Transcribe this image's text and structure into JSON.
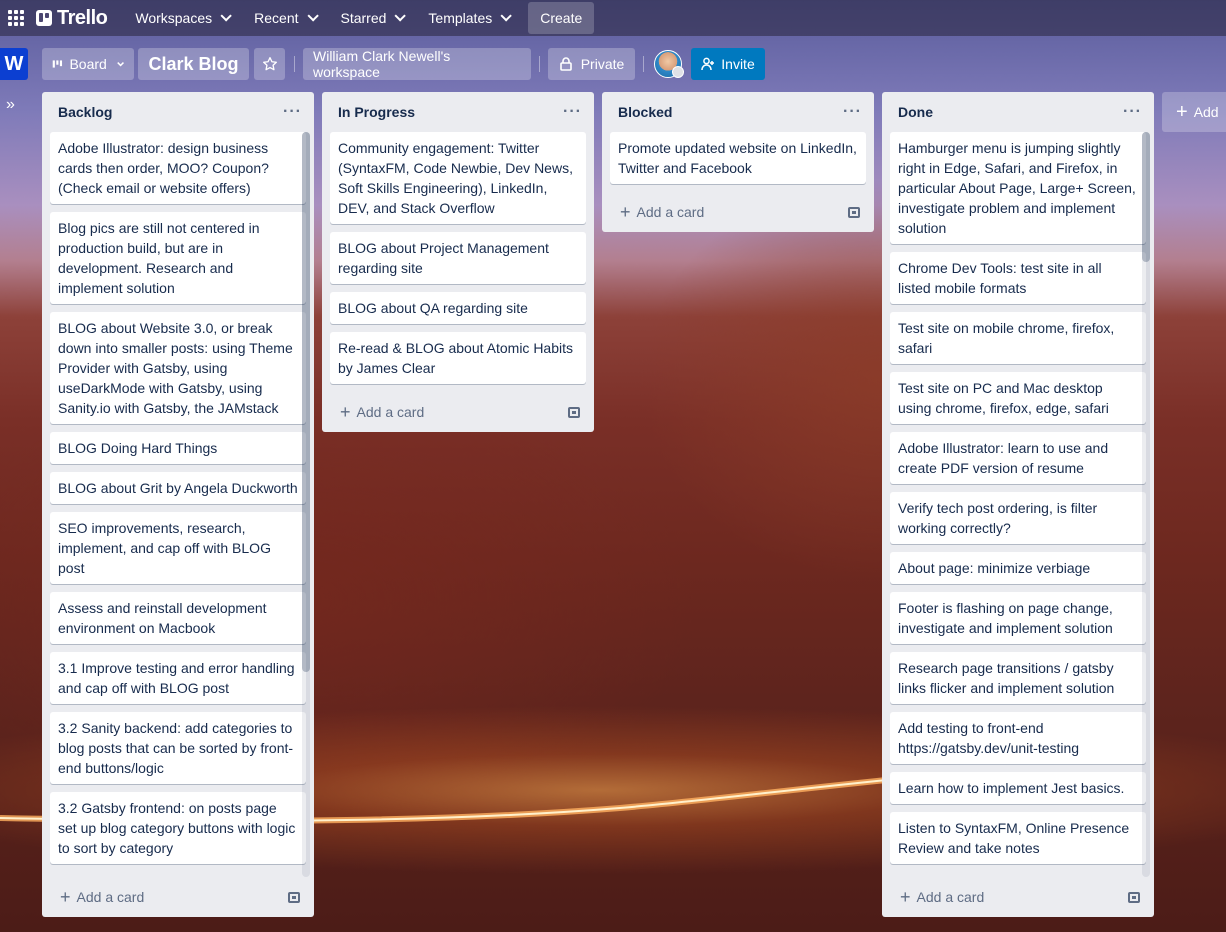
{
  "topnav": {
    "logo": "Trello",
    "items": [
      {
        "label": "Workspaces"
      },
      {
        "label": "Recent"
      },
      {
        "label": "Starred"
      },
      {
        "label": "Templates"
      }
    ],
    "create": "Create"
  },
  "board": {
    "workspace_badge": "W",
    "view_label": "Board",
    "title": "Clark Blog",
    "workspace_name": "William Clark Newell's workspace",
    "visibility": "Private",
    "invite_label": "Invite",
    "add_list_label": "Add"
  },
  "lists": [
    {
      "title": "Backlog",
      "cards": [
        "Adobe Illustrator: design business cards then order, MOO? Coupon? (Check email or website offers)",
        "Blog pics are still not centered in production build, but are in development. Research and implement solution",
        "BLOG about Website 3.0, or break down into smaller posts: using Theme Provider with Gatsby, using useDarkMode with Gatsby, using Sanity.io with Gatsby, the JAMstack",
        "BLOG Doing Hard Things",
        "BLOG about Grit by Angela Duckworth",
        "SEO improvements, research, implement, and cap off with BLOG post",
        "Assess and reinstall development environment on Macbook",
        "3.1 Improve testing and error handling and cap off with BLOG post",
        "3.2 Sanity backend: add categories to blog posts that can be sorted by front-end buttons/logic",
        "3.2 Gatsby frontend: on posts page set up blog category buttons with logic to sort by category"
      ],
      "add_card": "Add a card"
    },
    {
      "title": "In Progress",
      "cards": [
        "Community engagement: Twitter (SyntaxFM, Code Newbie, Dev News, Soft Skills Engineering), LinkedIn, DEV, and Stack Overflow",
        "BLOG about Project Management regarding site",
        "BLOG about QA regarding site",
        "Re-read & BLOG about Atomic Habits by James Clear"
      ],
      "add_card": "Add a card"
    },
    {
      "title": "Blocked",
      "cards": [
        "Promote updated website on LinkedIn, Twitter and Facebook"
      ],
      "add_card": "Add a card"
    },
    {
      "title": "Done",
      "cards": [
        "Hamburger menu is jumping slightly right in Edge, Safari, and Firefox, in particular About Page, Large+ Screen, investigate problem and implement solution",
        "Chrome Dev Tools: test site in all listed mobile formats",
        "Test site on mobile chrome, firefox, safari",
        "Test site on PC and Mac desktop using chrome, firefox, edge, safari",
        "Adobe Illustrator: learn to use and create PDF version of resume",
        "Verify tech post ordering, is filter working correctly?",
        "About page: minimize verbiage",
        "Footer is flashing on page change, investigate and implement solution",
        "Research page transitions / gatsby links flicker and implement solution",
        "Add testing to front-end https://gatsby.dev/unit-testing",
        "Learn how to implement Jest basics.",
        "Listen to SyntaxFM, Online Presence Review and take notes"
      ],
      "add_card": "Add a card"
    }
  ]
}
